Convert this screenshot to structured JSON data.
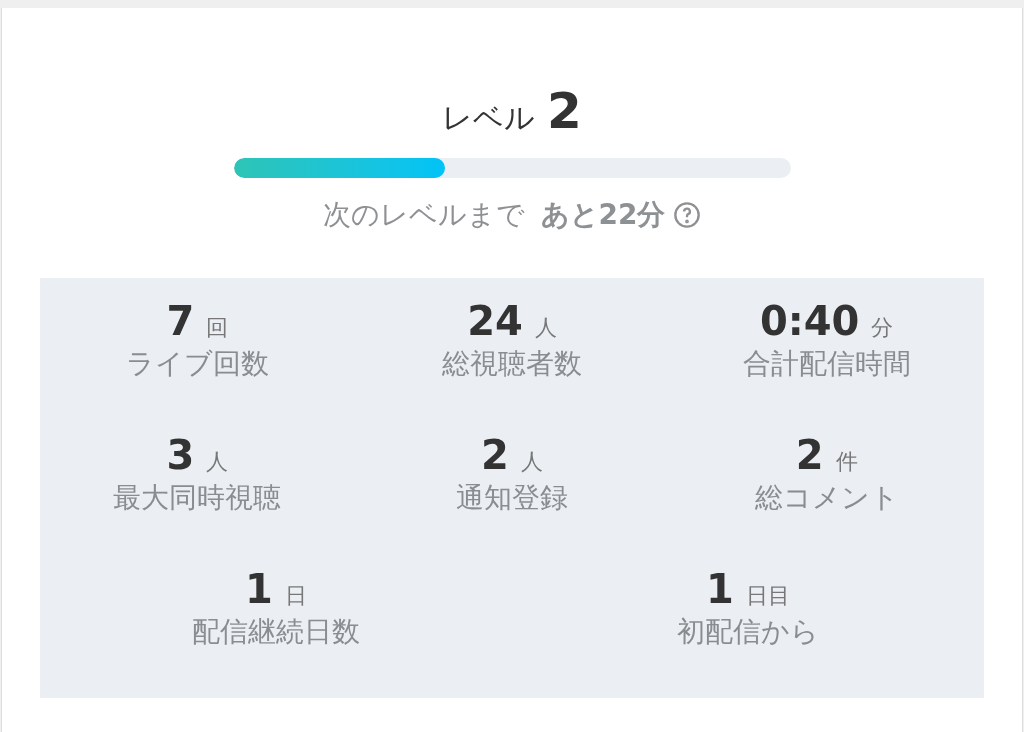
{
  "level": {
    "label": "レベル",
    "value": "2"
  },
  "progress": {
    "level": 0.38
  },
  "next_level": {
    "text": "次のレベルまで",
    "remaining": "あと22分"
  },
  "stats": [
    [
      {
        "value": "7",
        "unit": "回",
        "label": "ライブ回数"
      },
      {
        "value": "24",
        "unit": "人",
        "label": "総視聴者数"
      },
      {
        "value": "0:40",
        "unit": "分",
        "label": "合計配信時間"
      }
    ],
    [
      {
        "value": "3",
        "unit": "人",
        "label": "最大同時視聴"
      },
      {
        "value": "2",
        "unit": "人",
        "label": "通知登録"
      },
      {
        "value": "2",
        "unit": "件",
        "label": "総コメント"
      }
    ],
    [
      {
        "value": "1",
        "unit": "日",
        "label": "配信継続日数"
      },
      {
        "value": "1",
        "unit": "日目",
        "label": "初配信から"
      }
    ]
  ]
}
